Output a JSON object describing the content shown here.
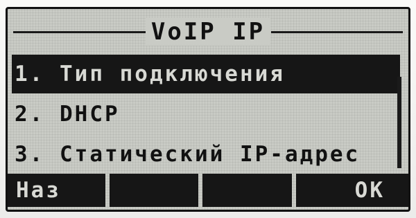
{
  "screen": {
    "title": "VoIP IP"
  },
  "menu": {
    "items": [
      {
        "label": "1. Тип подключения",
        "selected": true
      },
      {
        "label": "2. DHCP",
        "selected": false
      },
      {
        "label": "3. Статический IP-адрес",
        "selected": false
      }
    ]
  },
  "softkeys": {
    "left": "Наз",
    "middle1": "",
    "middle2": "",
    "right": "OK"
  },
  "colors": {
    "lcd_background": "#c9cbc5",
    "selection": "#161616",
    "text": "#111111"
  }
}
